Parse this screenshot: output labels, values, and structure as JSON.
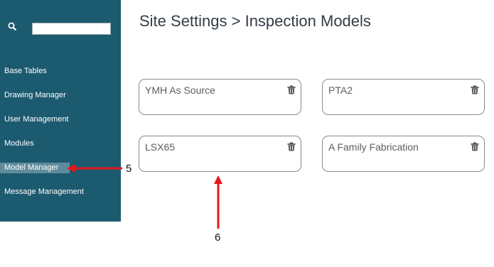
{
  "sidebar": {
    "search": {
      "value": "",
      "placeholder": ""
    },
    "items": [
      {
        "label": "Base Tables"
      },
      {
        "label": "Drawing Manager"
      },
      {
        "label": "User Management"
      },
      {
        "label": "Modules"
      },
      {
        "label": "Model Manager",
        "active": true
      },
      {
        "label": "Message Management"
      }
    ]
  },
  "header": {
    "title": "Site Settings > Inspection Models"
  },
  "models": [
    {
      "name": "YMH As Source"
    },
    {
      "name": "PTA2"
    },
    {
      "name": "LSX65"
    },
    {
      "name": "A Family Fabrication"
    }
  ],
  "annotations": {
    "label_5": "5",
    "label_6": "6",
    "arrow_color": "#e8141b"
  },
  "colors": {
    "sidebar_bg": "#1c5a70",
    "active_item_bg": "#5f8c9c"
  }
}
